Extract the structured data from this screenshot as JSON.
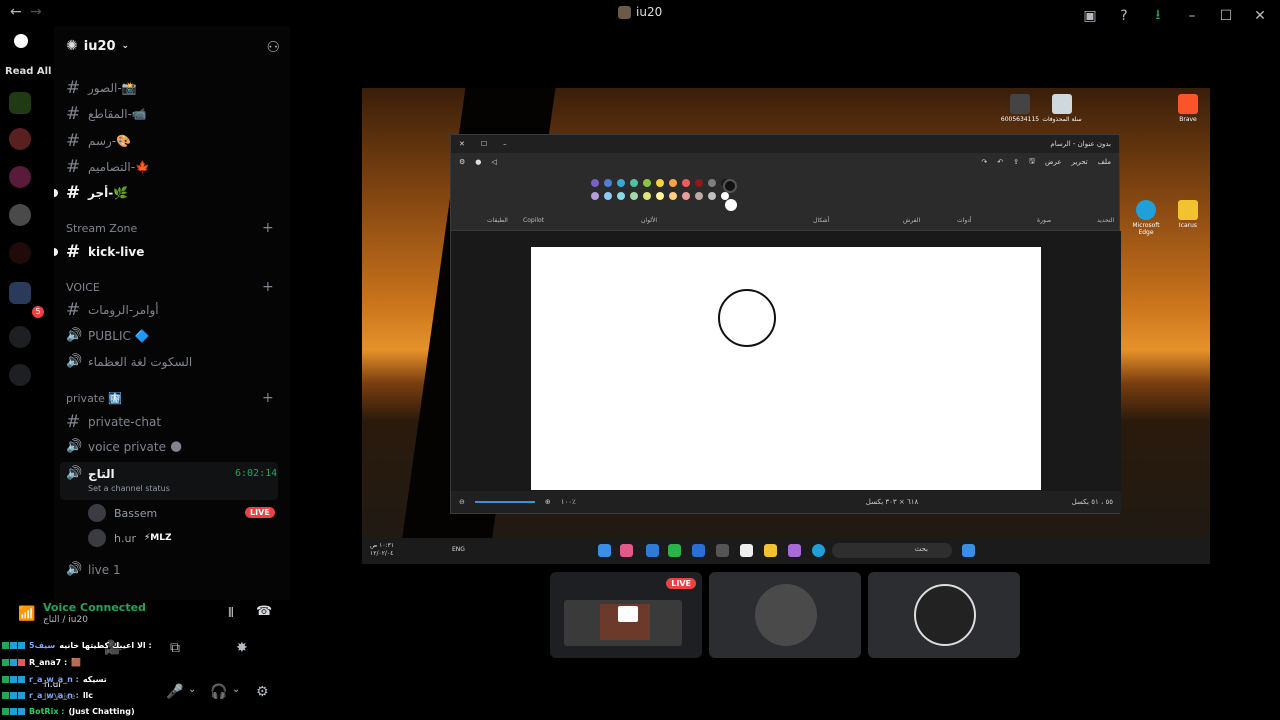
{
  "titlebar": {
    "title": "iu20",
    "back_glyph": "←",
    "forward_glyph": "→"
  },
  "rail": {
    "read_all": "Read All",
    "mention_count": "5"
  },
  "server": {
    "name": "iu20"
  },
  "channels": {
    "top": [
      {
        "name": "الصور-📸",
        "type": "text"
      },
      {
        "name": "المقاطع-📹",
        "type": "text"
      },
      {
        "name": "رسم-🎨",
        "type": "text"
      },
      {
        "name": "التصاميم-🍁",
        "type": "text"
      },
      {
        "name": "أجر-🌿",
        "type": "text"
      }
    ],
    "stream_zone_label": "Stream Zone",
    "kick_live": "kick-live",
    "voice_label": "VOICE",
    "voice": [
      {
        "name": "أوامر-الرومات",
        "type": "text"
      },
      {
        "name": "PUBLIC 🔷",
        "type": "voice"
      },
      {
        "name": "السكوت لغة العظماء",
        "type": "voice"
      }
    ],
    "private_label": "private 🩻",
    "private": [
      {
        "name": "private-chat",
        "type": "text"
      },
      {
        "name": "voice private 🌑",
        "type": "voice"
      }
    ],
    "active": {
      "name": "التاج",
      "status": "Set a channel status",
      "timer": "6:02:14"
    },
    "users": [
      {
        "name": "Bassem",
        "live": "LIVE"
      },
      {
        "name": "h.ur",
        "tag": "⚡MLZ"
      }
    ],
    "live1": "live 1"
  },
  "voice_panel": {
    "title": "Voice Connected",
    "subtitle": "التاج / iu20"
  },
  "paint": {
    "title": "بدون عنوان - الرسام",
    "menu": [
      "ملف",
      "تحرير",
      "عرض"
    ],
    "groups": [
      "التحديد",
      "صورة",
      "أدوات",
      "الفرش",
      "أشكال",
      "الألوان",
      "Copilot",
      "الطبقات"
    ],
    "zoom": "١٠٠٪",
    "dimensions": "٦١٨ × ٣٠٣ بكسل",
    "size": "٥٥ ، ٥١ بكسل",
    "palette": [
      "#7b61c4",
      "#4f7fd4",
      "#38a8d8",
      "#4fc0a0",
      "#8cc63f",
      "#f7d23a",
      "#f7a440",
      "#f15a5a",
      "#8b1a1a",
      "#7f7f7f",
      "#1a1a1a",
      "#b39ddb",
      "#90caf9",
      "#80deea",
      "#a5d6a7",
      "#dce775",
      "#fff59d",
      "#ffcc80",
      "#ef9a9a",
      "#bcaaa4",
      "#c0c0c0",
      "#ffffff"
    ]
  },
  "desktop": {
    "icons": [
      {
        "label": "6005634115"
      },
      {
        "label": "سلة المحذوفات"
      },
      {
        "label": "Brave"
      },
      {
        "label": "Microsoft Edge"
      },
      {
        "label": "Icarus"
      }
    ]
  },
  "taskbar": {
    "search": "بحث",
    "lang": "ENG",
    "time": "١٠:٣١ ص",
    "date": "١٢/٠٢/٠٤"
  },
  "tiles": {
    "live": "LIVE"
  },
  "chat": [
    {
      "user": "سيف5",
      "text": "الا اعيبك كطيتها خانيه :"
    },
    {
      "user": "R_ana7 :",
      "text": "🟫"
    },
    {
      "user": "r_a_w_a_n :",
      "text": "تسيكه"
    },
    {
      "user": "r_a_w_a_n :",
      "text": "llc"
    },
    {
      "user": "BotRix :",
      "text": "(Just Chatting)"
    }
  ],
  "user_panel": {
    "name": "h.ur",
    "status": "In Voice"
  }
}
